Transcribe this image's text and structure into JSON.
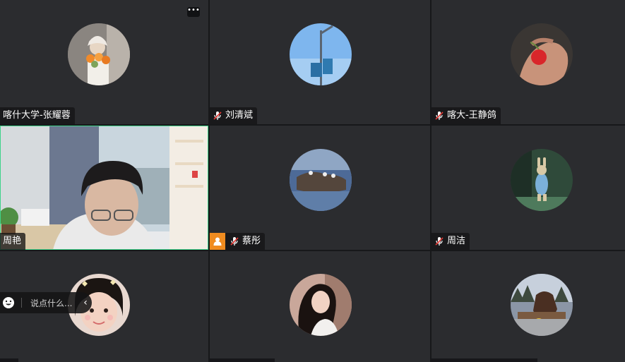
{
  "participants": [
    {
      "name": "喀什大学-张耀蓉",
      "muted": false
    },
    {
      "name": "刘清斌",
      "muted": true
    },
    {
      "name": "喀大-王静鸽",
      "muted": true
    },
    {
      "name": "周艳",
      "muted": false
    },
    {
      "name": "蔡彤",
      "muted": true,
      "host": true
    },
    {
      "name": "周洁",
      "muted": true
    }
  ],
  "chat": {
    "placeholder": "说点什么..."
  },
  "colors": {
    "tile_bg": "#2b2c2f",
    "active_speaker_border": "#3fd38a",
    "host_badge": "#f08c20"
  },
  "icons": {
    "more": "more-icon",
    "mic_off": "mic-off-icon",
    "host": "host-icon",
    "emoji": "emoji-icon",
    "collapse": "chevron-left-icon"
  }
}
